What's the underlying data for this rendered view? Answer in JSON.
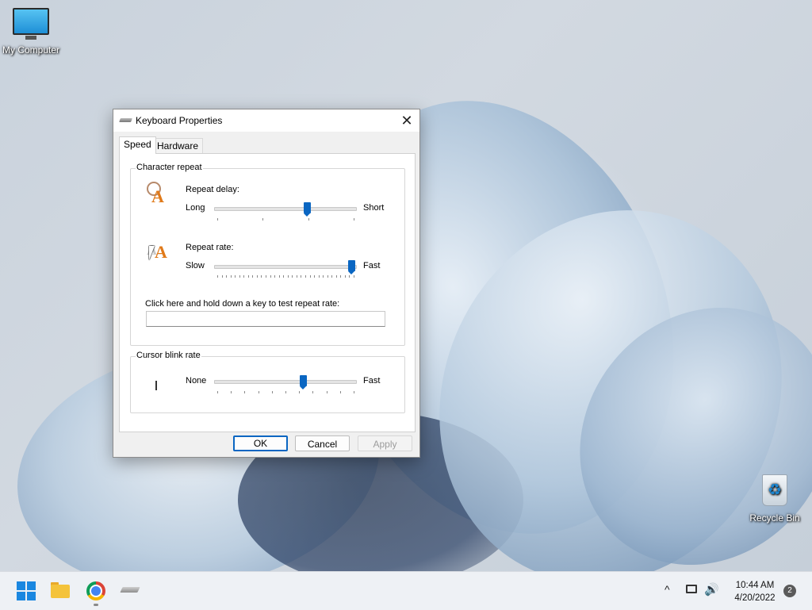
{
  "desktop": {
    "icons": [
      {
        "label": "My Computer"
      },
      {
        "label": "Recycle Bin"
      }
    ]
  },
  "dialog": {
    "title": "Keyboard Properties",
    "close_glyph": "✕",
    "tabs": [
      {
        "label": "Speed",
        "active": true
      },
      {
        "label": "Hardware",
        "active": false
      }
    ],
    "character_repeat": {
      "group_label": "Character repeat",
      "repeat_delay": {
        "label": "Repeat delay:",
        "min_label": "Long",
        "max_label": "Short",
        "level": 0.67
      },
      "repeat_rate": {
        "label": "Repeat rate:",
        "min_label": "Slow",
        "max_label": "Fast",
        "level": 1.0
      },
      "test_label": "Click here and hold down a key to test repeat rate:",
      "test_value": ""
    },
    "cursor_blink": {
      "group_label": "Cursor blink rate",
      "min_label": "None",
      "max_label": "Fast",
      "level": 0.64
    },
    "buttons": {
      "ok": "OK",
      "cancel": "Cancel",
      "apply": "Apply"
    }
  },
  "taskbar": {
    "apps": [
      {
        "icon": "windows-start-icon"
      },
      {
        "icon": "file-explorer-icon"
      },
      {
        "icon": "chrome-icon"
      },
      {
        "icon": "keyboard-app-icon"
      }
    ],
    "tray": {
      "chevron": "^",
      "volume": "🔊",
      "time": "10:44 AM",
      "date": "4/20/2022",
      "notifications": "2"
    }
  },
  "colors": {
    "accent": "#0a66c2",
    "taskbar": "#eef1f5",
    "dialog_bg": "#f0f0f0"
  }
}
